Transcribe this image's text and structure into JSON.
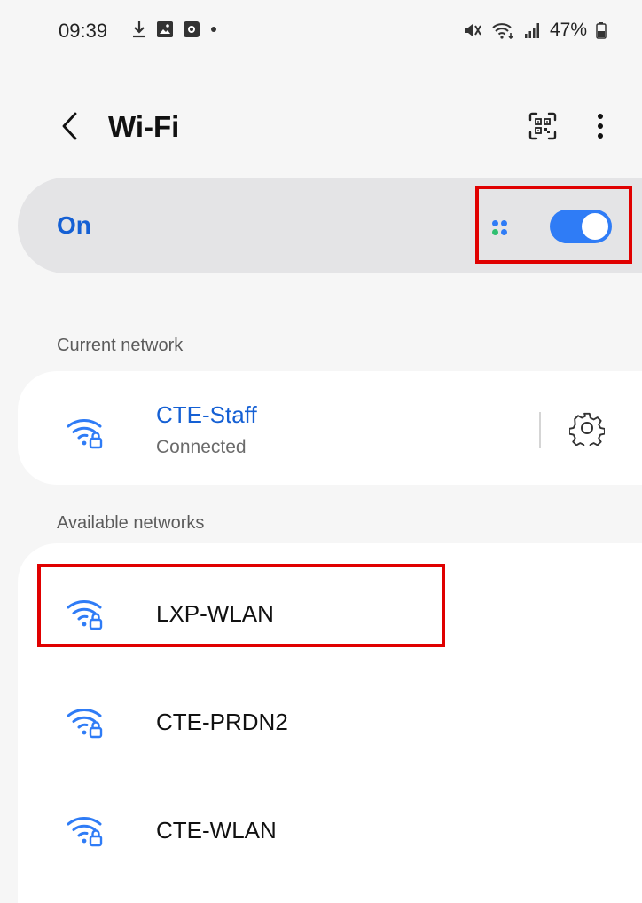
{
  "status_bar": {
    "time": "09:39",
    "battery_percent": "47%",
    "icons_left": [
      "download-icon",
      "image-icon",
      "notification-icon",
      "dot-icon"
    ],
    "icons_right": [
      "mute-icon",
      "wifi-status-icon",
      "signal-icon",
      "battery-icon"
    ]
  },
  "header": {
    "title": "Wi-Fi",
    "back_icon": "chevron-left-icon",
    "qr_icon": "qr-scan-icon",
    "more_icon": "more-vert-icon"
  },
  "wifi_toggle": {
    "label": "On",
    "state": true,
    "accent_color": "#2f7cf6",
    "label_color": "#1560d4"
  },
  "current_network": {
    "section_label": "Current network",
    "name": "CTE-Staff",
    "status": "Connected",
    "settings_icon": "gear-icon"
  },
  "available_networks": {
    "section_label": "Available networks",
    "items": [
      {
        "name": "LXP-WLAN",
        "icon": "wifi-lock-icon"
      },
      {
        "name": "CTE-PRDN2",
        "icon": "wifi-lock-icon"
      },
      {
        "name": "CTE-WLAN",
        "icon": "wifi-lock-icon"
      }
    ]
  },
  "annotation": {
    "highlight_color": "#e00000"
  }
}
